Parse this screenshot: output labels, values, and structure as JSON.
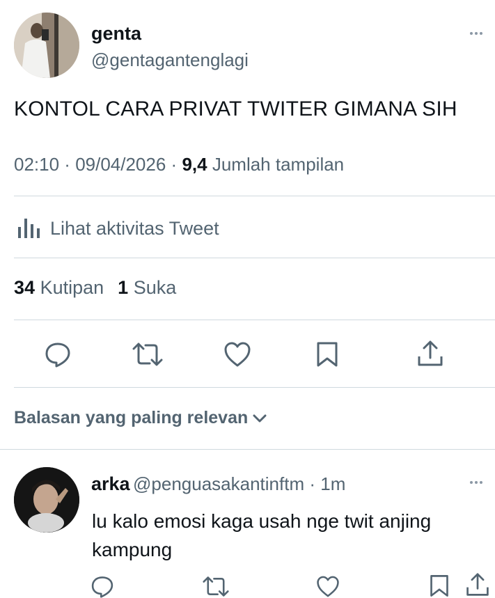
{
  "tweet": {
    "author_name": "genta",
    "author_handle": "@gentagantenglagi",
    "text": "KONTOL CARA PRIVAT TWITER GIMANA SIH",
    "time": "02:10",
    "date": "09/04/2026",
    "views_count": "9,4",
    "views_label": "Jumlah tampilan"
  },
  "activity": {
    "label": "Lihat aktivitas Tweet",
    "icon": "analytics-icon"
  },
  "stats": {
    "quotes_count": "34",
    "quotes_label": "Kutipan",
    "likes_count": "1",
    "likes_label": "Suka"
  },
  "actions": [
    "reply-icon",
    "retweet-icon",
    "like-icon",
    "bookmark-icon",
    "share-icon"
  ],
  "replies_sort": {
    "label": "Balasan yang paling relevan"
  },
  "reply": {
    "author_name": "arka",
    "author_handle": "@penguasakantinftm",
    "time": "1m",
    "text": "lu kalo emosi kaga usah nge twit anjing kampung"
  },
  "colors": {
    "text": "#0f1419",
    "secondary": "#536471",
    "divider": "#cfd9de"
  }
}
